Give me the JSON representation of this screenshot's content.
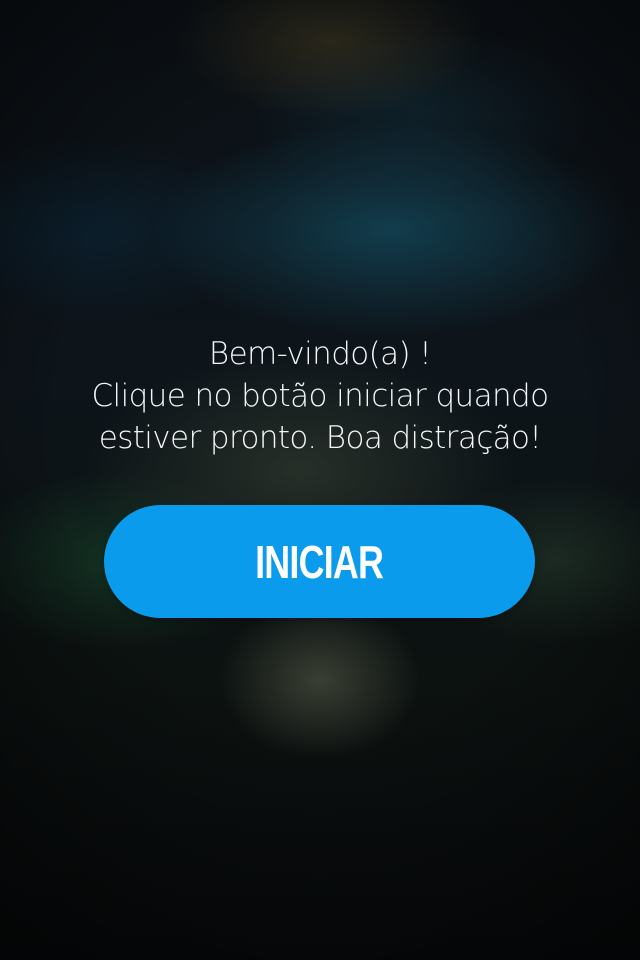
{
  "welcome": {
    "lines": [
      "Bem-vindo(a) !",
      "Clique no botão iniciar quando",
      "estiver pronto. Boa distração!"
    ]
  },
  "start_button": {
    "label": "INICIAR"
  },
  "colors": {
    "button_background": "#0a9bec",
    "text": "#ffffff",
    "background": "#0b0e12"
  }
}
